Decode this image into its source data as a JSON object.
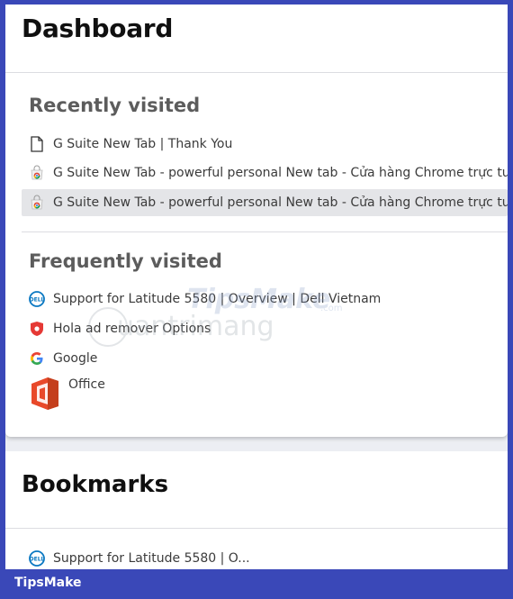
{
  "dashboard": {
    "title": "Dashboard",
    "recently_visited": {
      "title": "Recently visited",
      "items": [
        {
          "label": "G Suite New Tab | Thank You",
          "icon": "document-icon"
        },
        {
          "label": "G Suite New Tab - powerful personal New tab - Cửa hàng Chrome trực tuyến",
          "icon": "chrome-store-icon"
        },
        {
          "label": "G Suite New Tab - powerful personal New tab - Cửa hàng Chrome trực tuyến",
          "icon": "chrome-store-icon",
          "highlighted": true
        }
      ]
    },
    "frequently_visited": {
      "title": "Frequently visited",
      "items": [
        {
          "label": "Support for Latitude 5580 | Overview | Dell Vietnam",
          "icon": "dell-icon"
        },
        {
          "label": "Hola ad remover Options",
          "icon": "hola-shield-icon"
        },
        {
          "label": "Google",
          "icon": "google-icon"
        },
        {
          "label": "Office",
          "icon": "office-icon"
        }
      ]
    }
  },
  "bookmarks": {
    "title": "Bookmarks",
    "items": [
      {
        "label": "Support for Latitude 5580 | O...",
        "icon": "dell-icon"
      }
    ]
  },
  "watermark": {
    "brand": "TipsMake",
    "domain_suffix": ".com",
    "sub": "uantrimang"
  },
  "footer": {
    "label": "TipsMake"
  },
  "colors": {
    "frame": "#3a48b8",
    "highlight": "#e4e5e8",
    "heading": "#101010",
    "section": "#5c5c5c"
  }
}
